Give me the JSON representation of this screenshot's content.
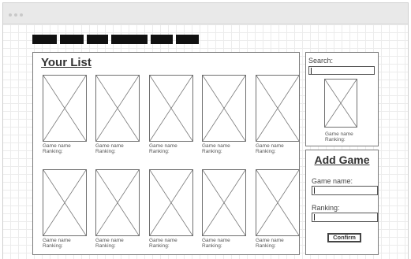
{
  "list": {
    "title": "Your List",
    "rows": [
      [
        {
          "name": "Game name",
          "ranking": "Ranking:"
        },
        {
          "name": "Game name",
          "ranking": "Ranking:"
        },
        {
          "name": "Game name",
          "ranking": "Ranking:"
        },
        {
          "name": "Game name",
          "ranking": "Ranking:"
        },
        {
          "name": "Game name",
          "ranking": "Ranking:"
        }
      ],
      [
        {
          "name": "Game name",
          "ranking": "Ranking:"
        },
        {
          "name": "Game name",
          "ranking": "Ranking:"
        },
        {
          "name": "Game name",
          "ranking": "Ranking:"
        },
        {
          "name": "Game name",
          "ranking": "Ranking:"
        },
        {
          "name": "Game name",
          "ranking": "Ranking:"
        }
      ]
    ]
  },
  "search": {
    "label": "Search:",
    "value": "",
    "result": {
      "name": "Game name",
      "ranking": "Ranking:"
    }
  },
  "add_game": {
    "title": "Add Game",
    "name_label": "Game name:",
    "name_value": "",
    "ranking_label": "Ranking:",
    "ranking_value": "",
    "confirm_label": "Confirm"
  }
}
